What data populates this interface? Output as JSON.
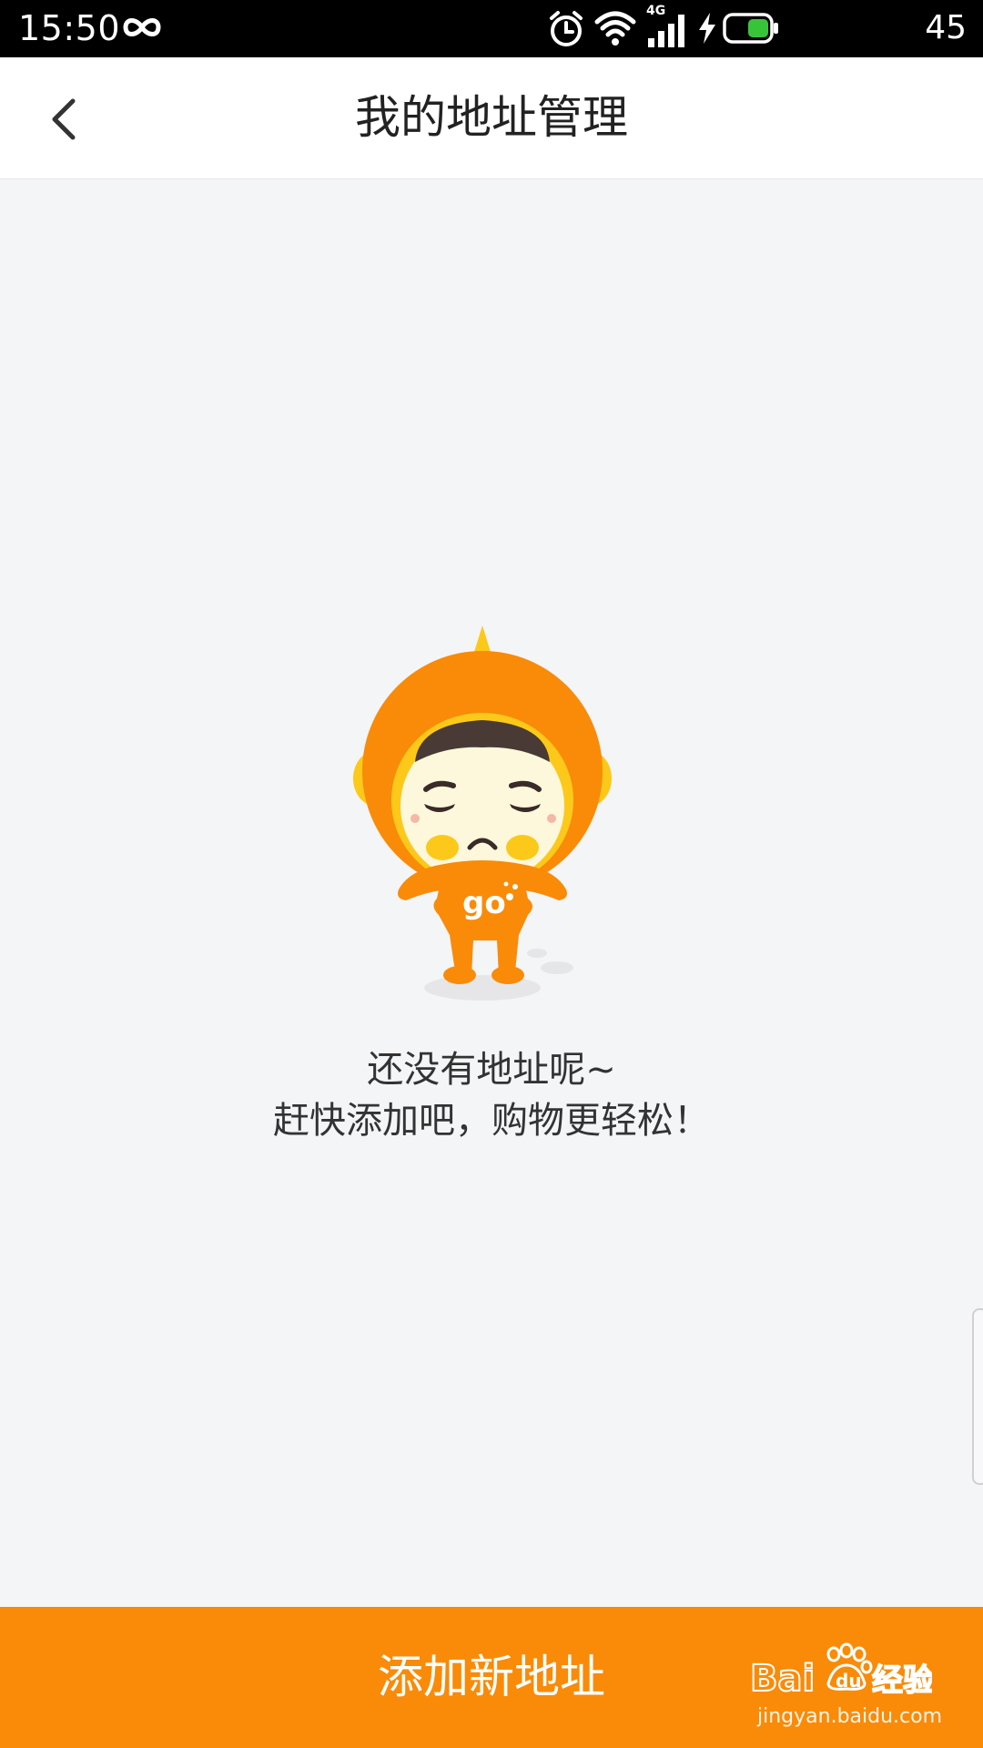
{
  "status_bar": {
    "time": "15:50",
    "network": "4G",
    "battery_level": "45",
    "icons": [
      "infinity-icon",
      "alarm-icon",
      "wifi-icon",
      "signal-icon",
      "charging-icon",
      "battery-icon"
    ]
  },
  "header": {
    "title": "我的地址管理",
    "back_icon": "chevron-left-icon"
  },
  "empty_state": {
    "line1": "还没有地址呢~",
    "line2": "赶快添加吧，购物更轻松！",
    "mascot": {
      "name": "sad-mascot-illustration",
      "shirt_text": "go"
    }
  },
  "bottom_bar": {
    "add_label": "添加新地址"
  },
  "watermark": {
    "logo": "Baidu经验",
    "domain": "jingyan.baidu.com"
  },
  "colors": {
    "accent": "#f98b08",
    "background": "#f4f5f7",
    "header_bg": "#ffffff",
    "title_text": "#222222",
    "status_bar_bg": "#000000",
    "battery_fill": "#38c43a"
  }
}
